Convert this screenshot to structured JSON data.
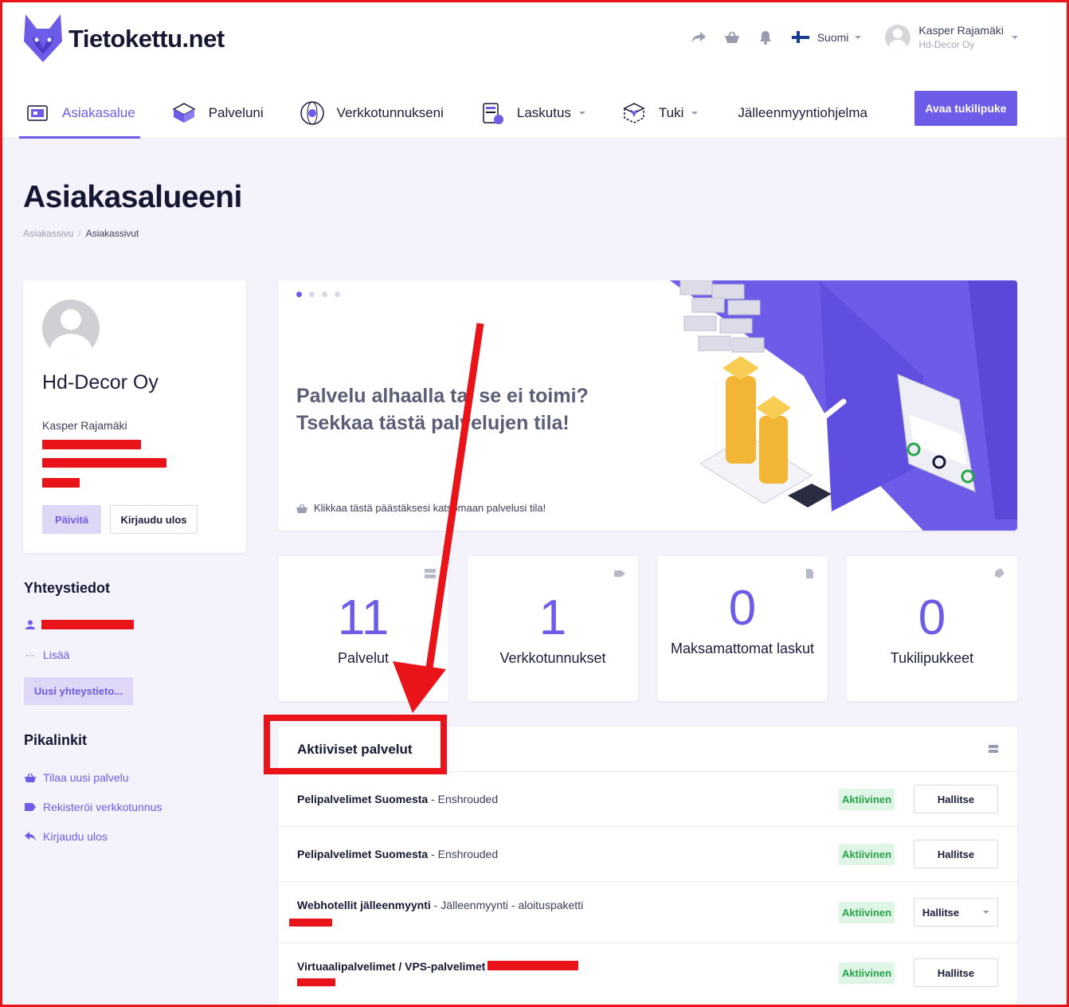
{
  "brand": {
    "name": "Tietokettu.net",
    "accent": "#6d5ce8"
  },
  "header": {
    "language": "Suomi",
    "user_name": "Kasper Rajamäki",
    "user_company": "Hd-Decor Oy"
  },
  "nav": {
    "items": [
      {
        "label": "Asiakasalue",
        "icon": "dashboard-icon"
      },
      {
        "label": "Palveluni",
        "icon": "box-icon"
      },
      {
        "label": "Verkkotunnukseni",
        "icon": "globe-icon"
      },
      {
        "label": "Laskutus",
        "icon": "invoice-icon"
      },
      {
        "label": "Tuki",
        "icon": "support-icon"
      },
      {
        "label": "Jälleenmyyntiohjelma"
      }
    ],
    "cta": "Avaa tukilipuke"
  },
  "page": {
    "title": "Asiakasalueeni",
    "breadcrumb": [
      "Asiakassivu",
      "Asiakassivut"
    ]
  },
  "profile": {
    "company": "Hd-Decor Oy",
    "name": "Kasper Rajamäki",
    "update_label": "Päivitä",
    "logout_label": "Kirjaudu ulos"
  },
  "contacts": {
    "title": "Yhteystiedot",
    "more_label": "Lisää",
    "new_label": "Uusi yhteystieto..."
  },
  "quicklinks": {
    "title": "Pikalinkit",
    "items": [
      "Tilaa uusi palvelu",
      "Rekisteröi verkkotunnus",
      "Kirjaudu ulos"
    ]
  },
  "banner": {
    "title": "Palvelu alhaalla tai se ei toimi? Tsekkaa tästä palvelujen tila!",
    "link": "Klikkaa tästä päästäksesi katsomaan palvelusi tila!"
  },
  "stats": [
    {
      "value": "11",
      "label": "Palvelut"
    },
    {
      "value": "1",
      "label": "Verkkotunnukset"
    },
    {
      "value": "0",
      "label": "Maksamattomat laskut"
    },
    {
      "value": "0",
      "label": "Tukilipukkeet"
    }
  ],
  "services": {
    "title": "Aktiiviset palvelut",
    "rows": [
      {
        "product": "Pelipalvelimet Suomesta",
        "detail": " - Enshrouded",
        "status": "Aktiivinen",
        "action": "Hallitse"
      },
      {
        "product": "Pelipalvelimet Suomesta",
        "detail": " - Enshrouded",
        "status": "Aktiivinen",
        "action": "Hallitse"
      },
      {
        "product": "Webhotellit jälleenmyynti",
        "detail": " - Jälleenmyynti - aloituspaketti",
        "status": "Aktiivinen",
        "action": "Hallitse"
      },
      {
        "product": "Virtuaalipalvelimet / VPS-palvelimet",
        "detail": " -",
        "status": "Aktiivinen",
        "action": "Hallitse"
      }
    ]
  }
}
